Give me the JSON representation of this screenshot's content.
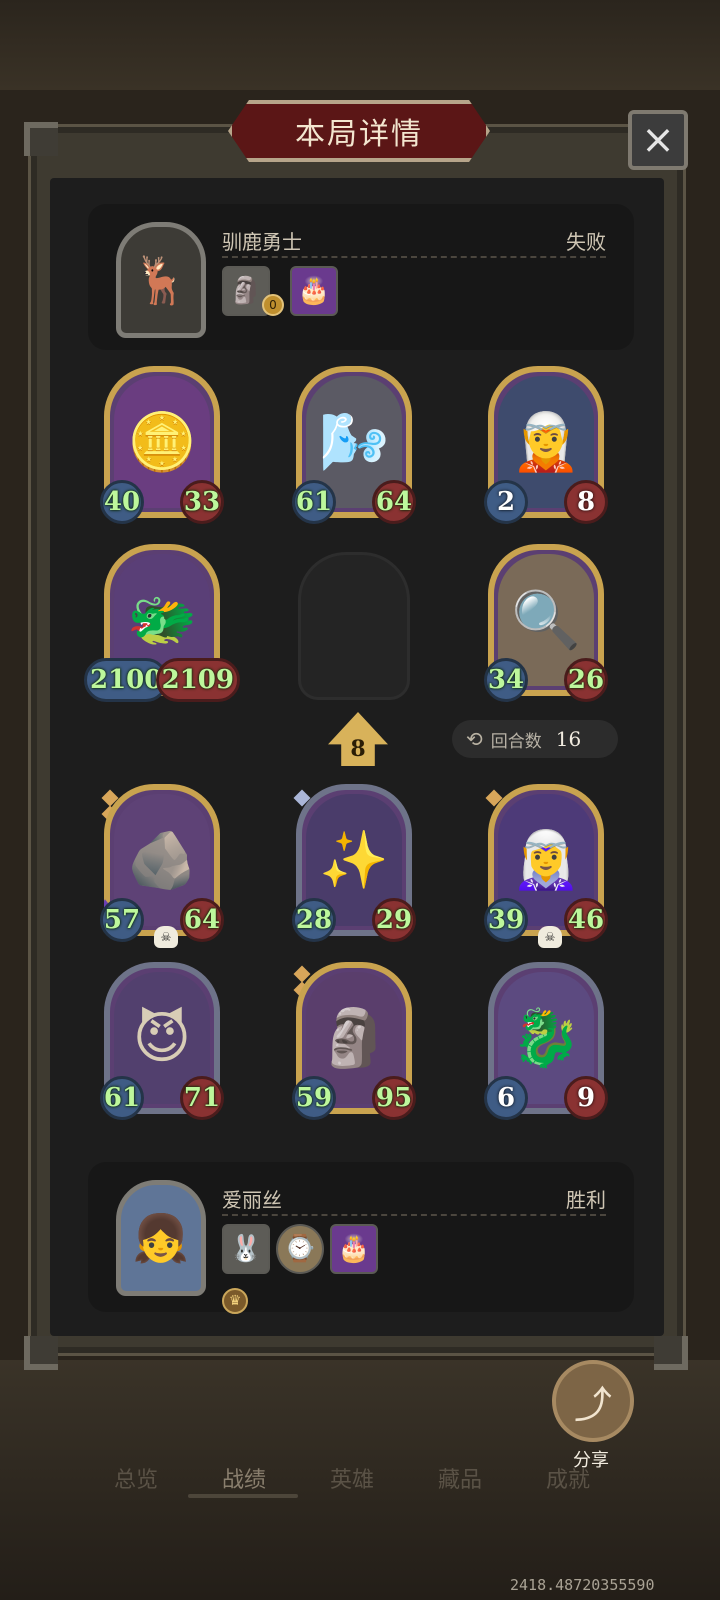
{
  "window": {
    "title": "本局详情",
    "close_icon": "×"
  },
  "top_player": {
    "name": "驯鹿勇士",
    "result": "失败",
    "portrait_icon": "🦌",
    "items": [
      {
        "icon": "🗿",
        "badge": "0"
      },
      {
        "icon": "🎂"
      }
    ]
  },
  "enemy_board": [
    {
      "name": "coin-golem",
      "icon": "🪙",
      "atk": "40",
      "hp": "33"
    },
    {
      "name": "windmill",
      "icon": "🌬️",
      "atk": "61",
      "hp": "64"
    },
    {
      "name": "elf-sorceress",
      "icon": "🧝",
      "atk": "2",
      "hp": "8"
    },
    {
      "name": "bone-dragon",
      "icon": "🐲",
      "atk": "2100",
      "hp": "2109"
    },
    {
      "name": "detective",
      "icon": "🔍",
      "atk": "34",
      "hp": "26"
    }
  ],
  "round_info": {
    "label": "回合数",
    "value": "16",
    "arrow_value": "8"
  },
  "player_board": [
    {
      "name": "rock-golem",
      "icon": "🪨",
      "atk": "57",
      "hp": "64"
    },
    {
      "name": "light-mage",
      "icon": "✨",
      "atk": "28",
      "hp": "29"
    },
    {
      "name": "blue-elf",
      "icon": "🧝‍♀️",
      "atk": "39",
      "hp": "46"
    },
    {
      "name": "horned-succubus",
      "icon": "😈",
      "atk": "61",
      "hp": "71"
    },
    {
      "name": "totem",
      "icon": "🗿",
      "atk": "59",
      "hp": "95"
    },
    {
      "name": "mech-dragon",
      "icon": "🐉",
      "atk": "6",
      "hp": "9"
    }
  ],
  "bottom_player": {
    "name": "爱丽丝",
    "result": "胜利",
    "portrait_icon": "👧",
    "items": [
      {
        "icon": "🐰"
      },
      {
        "icon": "⌚"
      },
      {
        "icon": "🎂"
      }
    ],
    "badge_icon": "♛"
  },
  "share": {
    "label": "分享",
    "icon": "⤴"
  },
  "tabs": [
    "总览",
    "战绩",
    "英雄",
    "藏品",
    "成就"
  ],
  "active_tab": "战绩",
  "footer_number": "2418.48720355590"
}
